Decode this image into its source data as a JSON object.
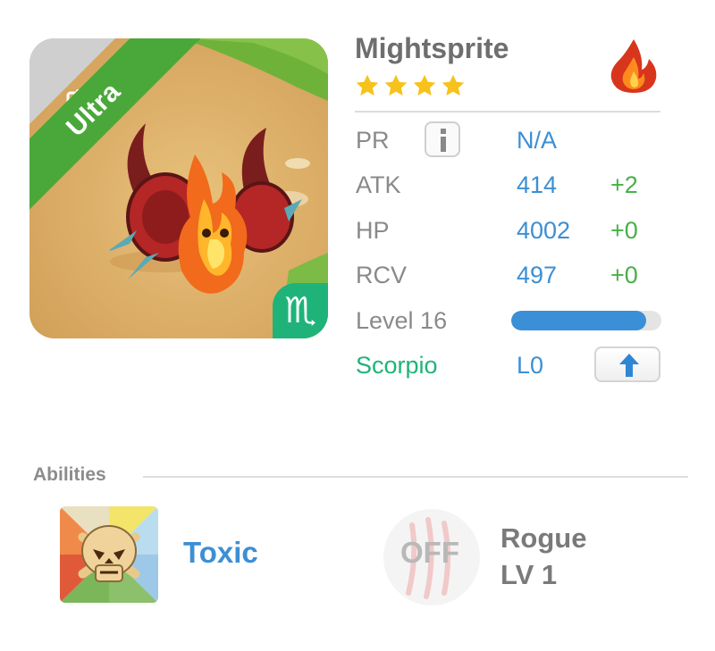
{
  "monster": {
    "name": "Mightsprite",
    "rarity": "Ultra",
    "star_count": 4,
    "element_icon": "fire-element-icon",
    "zodiac_symbol": "♏"
  },
  "stats": {
    "pr": {
      "label": "PR",
      "value": "N/A"
    },
    "atk": {
      "label": "ATK",
      "value": "414",
      "bonus": "+2"
    },
    "hp": {
      "label": "HP",
      "value": "4002",
      "bonus": "+0"
    },
    "rcv": {
      "label": "RCV",
      "value": "497",
      "bonus": "+0"
    }
  },
  "level": {
    "label": "Level 16",
    "progress_percent": 90
  },
  "zodiac": {
    "label": "Scorpio",
    "value": "L0"
  },
  "abilities": {
    "title": "Abilities",
    "primary": {
      "label": "Toxic",
      "icon": "skull-icon"
    },
    "secondary": {
      "status": "OFF",
      "name": "Rogue",
      "level": "LV 1",
      "icon": "claw-scratch-icon"
    }
  },
  "colors": {
    "accent_blue": "#3c8fd4",
    "bonus_green": "#48b048",
    "ultra_green": "#4aa83a",
    "scorpio_teal": "#1fb37a",
    "star_yellow": "#f7c21b"
  }
}
